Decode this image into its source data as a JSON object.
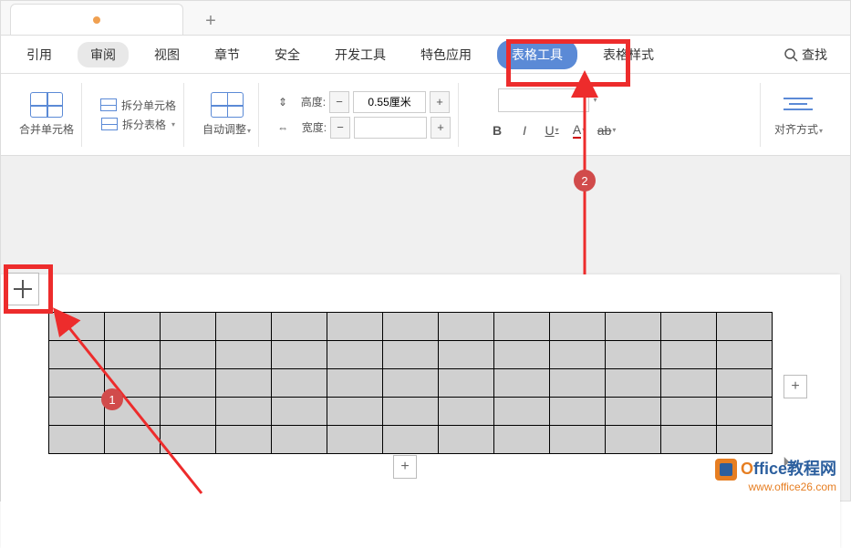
{
  "menu": {
    "items": [
      "引用",
      "审阅",
      "视图",
      "章节",
      "安全",
      "开发工具",
      "特色应用",
      "表格工具",
      "表格样式"
    ],
    "find": "查找"
  },
  "ribbon": {
    "mergeCells": "合并单元格",
    "splitCells": "拆分单元格",
    "splitTable": "拆分表格",
    "autoFit": "自动调整",
    "heightLabel": "高度:",
    "widthLabel": "宽度:",
    "heightValue": "0.55厘米",
    "widthValue": "",
    "bold": "B",
    "italic": "I",
    "underline": "U",
    "fontColor": "A",
    "highlight": "ab",
    "alignLabel": "对齐方式"
  },
  "badges": {
    "b1": "1",
    "b2": "2"
  },
  "watermark": {
    "title_o": "O",
    "title_rest1": "ffice",
    "title_cn": "教程网",
    "url": "www.office26.com"
  }
}
